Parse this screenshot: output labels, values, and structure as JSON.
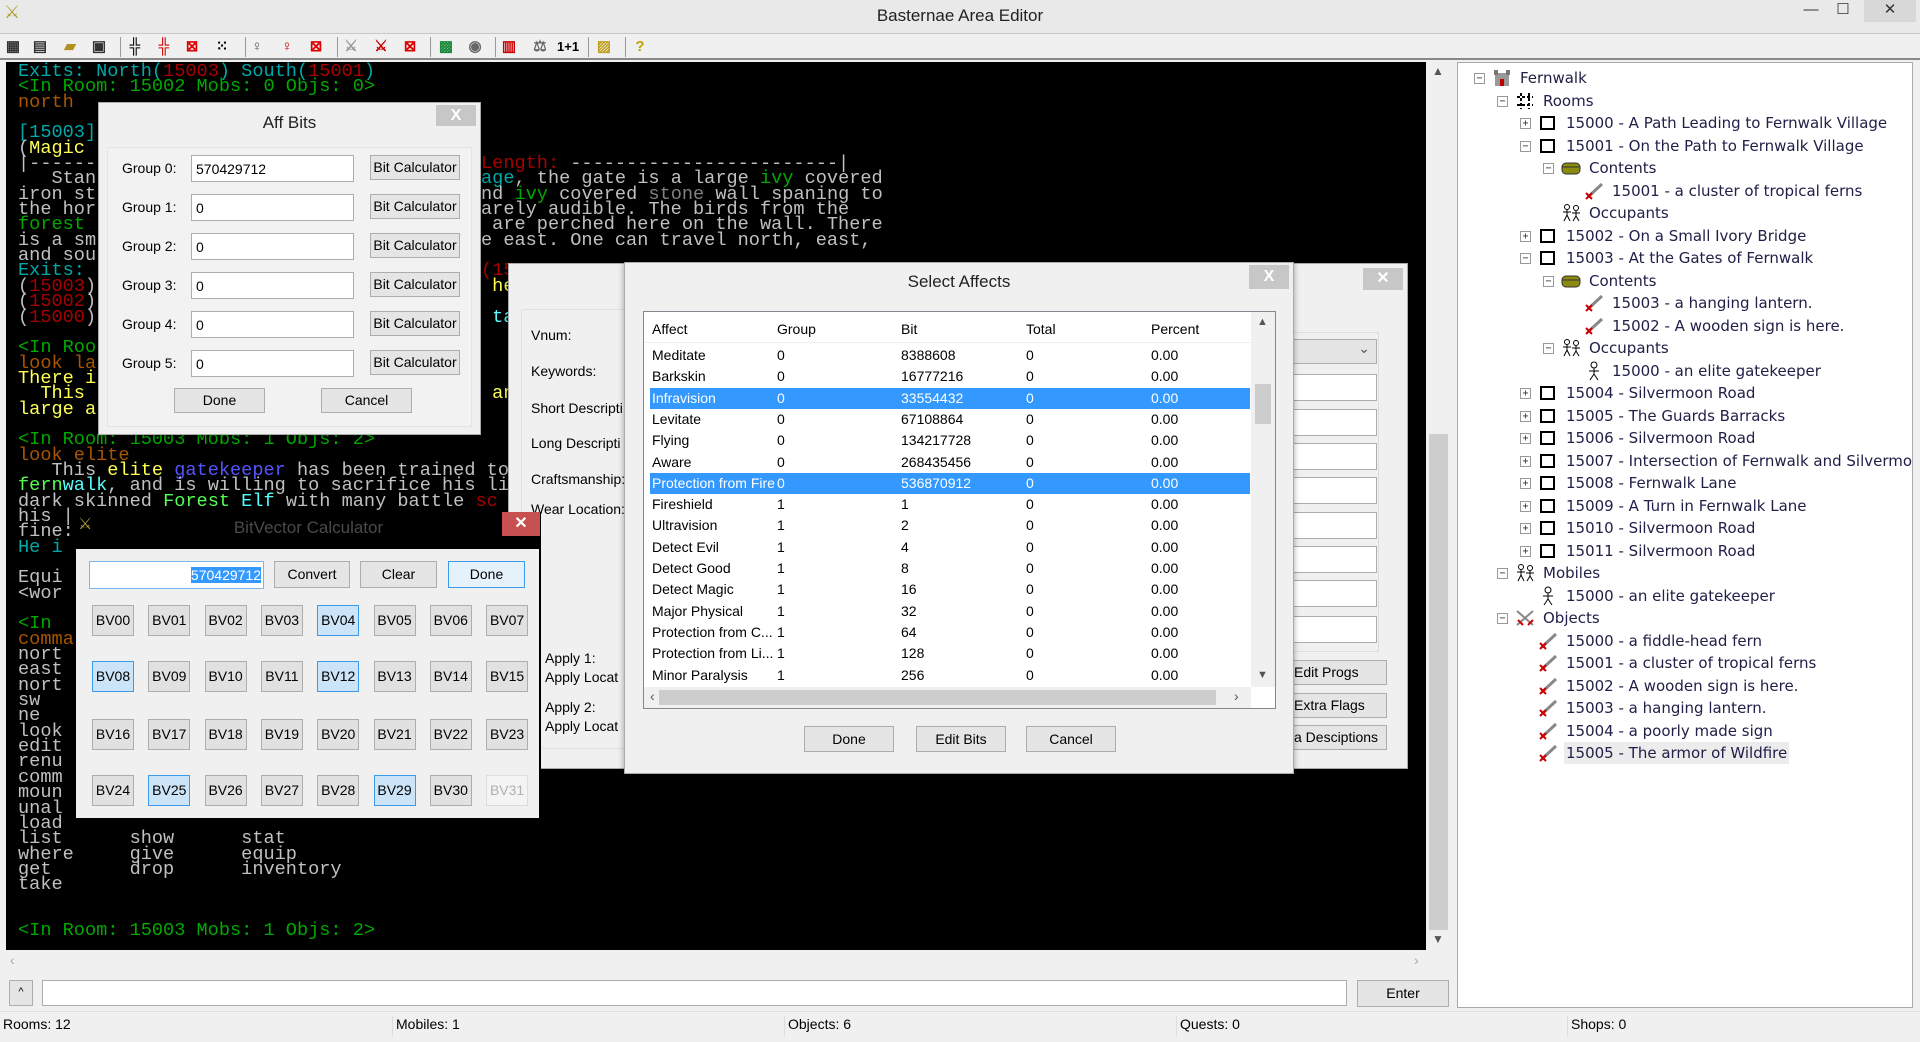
{
  "window": {
    "title": "Basternae Area Editor",
    "minimize": "—",
    "maximize": "☐",
    "close": "✕"
  },
  "toolbar": {
    "icons": [
      "new-area-icon",
      "area-properties-icon",
      "open-folder-icon",
      "save-icon",
      "rooms-icon",
      "new-room-icon",
      "delete-room-icon",
      "room-grid-icon",
      "mobile-icon",
      "new-mobile-icon",
      "delete-mobile-icon",
      "object-icon",
      "new-object-icon",
      "delete-object-icon",
      "map-icon",
      "compass-icon",
      "bar-chart-icon",
      "balance-icon",
      "calculator-icon",
      "image-folder-icon",
      "help-icon"
    ],
    "calc_label": "1+1",
    "help_label": "?"
  },
  "terminal": {
    "palette": {
      "w": "#c0c0c0",
      "c": "#00a8a8",
      "C": "#54ffff",
      "r": "#a80000",
      "g": "#00a800",
      "G": "#54ff54",
      "o": "#a85400",
      "y": "#ffff54",
      "b": "#5454ff",
      "k": "#808080"
    },
    "lines": [
      {
        "l": [
          [
            "Exits: North(",
            "c"
          ],
          [
            "15003",
            "r"
          ],
          [
            ") South(",
            "c"
          ],
          [
            "15001",
            "r"
          ],
          [
            ")",
            "c"
          ]
        ]
      },
      {
        "l": [
          [
            "<In Room: 15002 Mobs: 0 Objs: 0>",
            "g"
          ]
        ]
      },
      {
        "l": [
          [
            "north",
            "o"
          ]
        ]
      },
      {
        "l": []
      },
      {
        "l": [
          [
            "[15003]",
            "c"
          ]
        ]
      },
      {
        "l": [
          [
            "(",
            "w"
          ],
          [
            "Magic ",
            "y"
          ]
        ]
      },
      {
        "l": [
          [
            "|------",
            "w"
          ]
        ],
        "r": [
          [
            "Length: ",
            "r"
          ],
          [
            "------------------------|",
            "w"
          ]
        ]
      },
      {
        "l": [
          [
            "   Stan",
            "w"
          ]
        ],
        "r": [
          [
            "age",
            "c"
          ],
          [
            ", the gate is a large ",
            "w"
          ],
          [
            "ivy",
            "g"
          ],
          [
            " covered",
            "w"
          ]
        ]
      },
      {
        "l": [
          [
            "iron st",
            "w"
          ]
        ],
        "r": [
          [
            "nd ",
            "w"
          ],
          [
            "ivy",
            "g"
          ],
          [
            " covered ",
            "w"
          ],
          [
            "stone",
            "k"
          ],
          [
            " wall spaning to",
            "w"
          ]
        ]
      },
      {
        "l": [
          [
            "the hor",
            "w"
          ]
        ],
        "r": [
          [
            "arely audible. The birds from the",
            "w"
          ]
        ]
      },
      {
        "l": [
          [
            "forest ",
            "g"
          ]
        ],
        "r": [
          [
            " are perched here on the wall. There",
            "w"
          ]
        ]
      },
      {
        "l": [
          [
            "is a sm",
            "w"
          ]
        ],
        "r": [
          [
            "e east. One can travel north, east,",
            "w"
          ]
        ]
      },
      {
        "l": [
          [
            "and sou",
            "w"
          ]
        ]
      },
      {
        "l": [
          [
            "Exits: ",
            "c"
          ]
        ],
        "r": [
          [
            "(15",
            "r"
          ]
        ]
      },
      {
        "l": [
          [
            "(",
            "w"
          ],
          [
            "15003",
            "r"
          ],
          [
            ")",
            "w"
          ]
        ],
        "r": [
          [
            " he",
            "y"
          ]
        ]
      },
      {
        "l": [
          [
            "(",
            "w"
          ],
          [
            "15002",
            "r"
          ],
          [
            ")",
            "w"
          ]
        ]
      },
      {
        "l": [
          [
            "(",
            "w"
          ],
          [
            "15000",
            "r"
          ],
          [
            ")",
            "w"
          ]
        ],
        "r": [
          [
            " tan",
            "C"
          ]
        ]
      },
      {
        "l": []
      },
      {
        "l": [
          [
            "<In Roo",
            "g"
          ]
        ]
      },
      {
        "l": [
          [
            "look la",
            "o"
          ]
        ]
      },
      {
        "l": [
          [
            "There i",
            "y"
          ]
        ]
      },
      {
        "l": [
          [
            "  This ",
            "y"
          ]
        ],
        "r": [
          [
            " and",
            "y"
          ]
        ]
      },
      {
        "l": [
          [
            "large a",
            "y"
          ]
        ]
      },
      {
        "l": []
      },
      {
        "l": [
          [
            "<In Room: 15003 Mobs: 1 Objs: 2>",
            "g"
          ]
        ]
      },
      {
        "l": [
          [
            "look elite",
            "o"
          ]
        ]
      },
      {
        "l": [
          [
            "   This ",
            "w"
          ],
          [
            "elite ",
            "y"
          ],
          [
            "gatekeeper",
            "b"
          ],
          [
            " has been trained to",
            "w"
          ]
        ]
      },
      {
        "l": [
          [
            "fern",
            "G"
          ],
          [
            "walk",
            "C"
          ],
          [
            ", and is willing to sacrifice his li",
            "w"
          ]
        ]
      },
      {
        "l": [
          [
            "dark skinned ",
            "w"
          ],
          [
            "Forest ",
            "G"
          ],
          [
            "Elf",
            "C"
          ],
          [
            " with many battle ",
            "w"
          ],
          [
            "sc",
            "r"
          ]
        ]
      },
      {
        "l": [
          [
            "his |",
            "w"
          ]
        ]
      },
      {
        "l": [
          [
            "fine:",
            "w"
          ]
        ]
      },
      {
        "l": [
          [
            "He i",
            "c"
          ]
        ]
      },
      {
        "l": []
      },
      {
        "l": [
          [
            "Equi",
            "w"
          ]
        ]
      },
      {
        "l": [
          [
            "<wor",
            "w"
          ]
        ]
      },
      {
        "l": []
      },
      {
        "l": [
          [
            "<In ",
            "g"
          ]
        ]
      },
      {
        "l": [
          [
            "comma",
            "o"
          ]
        ]
      },
      {
        "l": [
          [
            "nort",
            "w"
          ]
        ]
      },
      {
        "l": [
          [
            "east",
            "w"
          ]
        ]
      },
      {
        "l": [
          [
            "nort",
            "w"
          ]
        ]
      },
      {
        "l": [
          [
            "sw",
            "w"
          ]
        ]
      },
      {
        "l": [
          [
            "ne",
            "w"
          ]
        ]
      },
      {
        "l": [
          [
            "look",
            "w"
          ]
        ]
      },
      {
        "l": [
          [
            "edit",
            "w"
          ]
        ]
      },
      {
        "l": [
          [
            "renu",
            "w"
          ]
        ]
      },
      {
        "l": [
          [
            "comm",
            "w"
          ]
        ]
      },
      {
        "l": [
          [
            "moun",
            "w"
          ]
        ]
      },
      {
        "l": [
          [
            "unal",
            "w"
          ]
        ]
      },
      {
        "l": [
          [
            "load",
            "w"
          ]
        ]
      },
      {
        "l": [
          [
            "list      show      stat",
            "w"
          ]
        ]
      },
      {
        "l": [
          [
            "where     give      equip",
            "w"
          ]
        ]
      },
      {
        "l": [
          [
            "get       drop      inventory",
            "w"
          ]
        ]
      },
      {
        "l": [
          [
            "take",
            "w"
          ]
        ]
      },
      {
        "l": []
      },
      {
        "l": []
      },
      {
        "l": [
          [
            "<In Room: 15003 Mobs: 1 Objs: 2>",
            "g"
          ]
        ]
      }
    ]
  },
  "command": {
    "history_button": "^",
    "input_value": "",
    "enter_label": "Enter"
  },
  "tree": {
    "rows": [
      {
        "level": 0,
        "exp": "-",
        "icon": "castle",
        "label": "Fernwalk"
      },
      {
        "level": 1,
        "exp": "-",
        "icon": "rooms",
        "label": "Rooms"
      },
      {
        "level": 2,
        "exp": "+",
        "icon": "room",
        "label": "15000 - A Path Leading to Fernwalk Village"
      },
      {
        "level": 2,
        "exp": "-",
        "icon": "room",
        "label": "15001 - On the Path to Fernwalk Village"
      },
      {
        "level": 3,
        "exp": "-",
        "icon": "chest",
        "label": "Contents"
      },
      {
        "level": 4,
        "exp": "",
        "icon": "object",
        "label": "15001 - a cluster of tropical ferns"
      },
      {
        "level": 3,
        "exp": "",
        "icon": "mobs",
        "label": "Occupants"
      },
      {
        "level": 2,
        "exp": "+",
        "icon": "room",
        "label": "15002 - On a Small Ivory Bridge"
      },
      {
        "level": 2,
        "exp": "-",
        "icon": "room",
        "label": "15003 - At the Gates of Fernwalk"
      },
      {
        "level": 3,
        "exp": "-",
        "icon": "chest",
        "label": "Contents"
      },
      {
        "level": 4,
        "exp": "",
        "icon": "object",
        "label": "15003 - a hanging lantern."
      },
      {
        "level": 4,
        "exp": "",
        "icon": "object",
        "label": "15002 - A wooden sign is here."
      },
      {
        "level": 3,
        "exp": "-",
        "icon": "mobs",
        "label": "Occupants"
      },
      {
        "level": 4,
        "exp": "",
        "icon": "mob",
        "label": "15000 - an elite gatekeeper"
      },
      {
        "level": 2,
        "exp": "+",
        "icon": "room",
        "label": "15004 - Silvermoon Road"
      },
      {
        "level": 2,
        "exp": "+",
        "icon": "room",
        "label": "15005 - The Guards Barracks"
      },
      {
        "level": 2,
        "exp": "+",
        "icon": "room",
        "label": "15006 - Silvermoon Road"
      },
      {
        "level": 2,
        "exp": "+",
        "icon": "room",
        "label": "15007 - Intersection of Fernwalk and Silvermoon"
      },
      {
        "level": 2,
        "exp": "+",
        "icon": "room",
        "label": "15008 - Fernwalk Lane"
      },
      {
        "level": 2,
        "exp": "+",
        "icon": "room",
        "label": "15009 - A Turn in Fernwalk Lane"
      },
      {
        "level": 2,
        "exp": "+",
        "icon": "room",
        "label": "15010 - Silvermoon Road"
      },
      {
        "level": 2,
        "exp": "+",
        "icon": "room",
        "label": "15011 - Silvermoon Road"
      },
      {
        "level": 1,
        "exp": "-",
        "icon": "mobs",
        "label": "Mobiles"
      },
      {
        "level": 2,
        "exp": "",
        "icon": "mob",
        "label": "15000 - an elite gatekeeper"
      },
      {
        "level": 1,
        "exp": "-",
        "icon": "objects",
        "label": "Objects"
      },
      {
        "level": 2,
        "exp": "",
        "icon": "object",
        "label": "15000 - a fiddle-head fern"
      },
      {
        "level": 2,
        "exp": "",
        "icon": "object",
        "label": "15001 - a cluster of tropical ferns"
      },
      {
        "level": 2,
        "exp": "",
        "icon": "object",
        "label": "15002 - A wooden sign is here."
      },
      {
        "level": 2,
        "exp": "",
        "icon": "object",
        "label": "15003 - a hanging lantern."
      },
      {
        "level": 2,
        "exp": "",
        "icon": "object",
        "label": "15004 - a poorly made sign"
      },
      {
        "level": 2,
        "exp": "",
        "icon": "object",
        "label": "15005 - The armor of Wildfire",
        "selected": true
      }
    ]
  },
  "status": {
    "rooms": "Rooms: 12",
    "mobiles": "Mobiles: 1",
    "objects": "Objects: 6",
    "quests": "Quests: 0",
    "shops": "Shops: 0"
  },
  "aff_bits": {
    "title": "Aff Bits",
    "close": "X",
    "groups": [
      {
        "label": "Group 0:",
        "value": "570429712"
      },
      {
        "label": "Group 1:",
        "value": "0"
      },
      {
        "label": "Group 2:",
        "value": "0"
      },
      {
        "label": "Group 3:",
        "value": "0"
      },
      {
        "label": "Group 4:",
        "value": "0"
      },
      {
        "label": "Group 5:",
        "value": "0"
      }
    ],
    "calc_label": "Bit Calculator",
    "done": "Done",
    "cancel": "Cancel"
  },
  "object_editor": {
    "close": "✕",
    "labels": [
      "Vnum:",
      "Keywords:",
      "Short Descripti",
      "Long Descripti",
      "Craftsmanship:",
      "Wear Location:"
    ],
    "apply1": "Apply 1:",
    "apply1_loc": "Apply Locat",
    "apply2": "Apply 2:",
    "apply2_loc": "Apply Locat",
    "edit_progs": "Edit Progs",
    "extra_flags": "Extra Flags",
    "extra_desc": "a Desciptions"
  },
  "select_affects": {
    "title": "Select Affects",
    "close": "X",
    "columns": [
      "Affect",
      "Group",
      "Bit",
      "Total",
      "Percent"
    ],
    "rows": [
      {
        "affect": "Meditate",
        "group": "0",
        "bit": "8388608",
        "total": "0",
        "percent": "0.00"
      },
      {
        "affect": "Barkskin",
        "group": "0",
        "bit": "16777216",
        "total": "0",
        "percent": "0.00"
      },
      {
        "affect": "Infravision",
        "group": "0",
        "bit": "33554432",
        "total": "0",
        "percent": "0.00",
        "selected": true
      },
      {
        "affect": "Levitate",
        "group": "0",
        "bit": "67108864",
        "total": "0",
        "percent": "0.00"
      },
      {
        "affect": "Flying",
        "group": "0",
        "bit": "134217728",
        "total": "0",
        "percent": "0.00"
      },
      {
        "affect": "Aware",
        "group": "0",
        "bit": "268435456",
        "total": "0",
        "percent": "0.00"
      },
      {
        "affect": "Protection from Fire",
        "group": "0",
        "bit": "536870912",
        "total": "0",
        "percent": "0.00",
        "selected": true
      },
      {
        "affect": "Fireshield",
        "group": "1",
        "bit": "1",
        "total": "0",
        "percent": "0.00"
      },
      {
        "affect": "Ultravision",
        "group": "1",
        "bit": "2",
        "total": "0",
        "percent": "0.00"
      },
      {
        "affect": "Detect Evil",
        "group": "1",
        "bit": "4",
        "total": "0",
        "percent": "0.00"
      },
      {
        "affect": "Detect Good",
        "group": "1",
        "bit": "8",
        "total": "0",
        "percent": "0.00"
      },
      {
        "affect": "Detect Magic",
        "group": "1",
        "bit": "16",
        "total": "0",
        "percent": "0.00"
      },
      {
        "affect": "Major Physical",
        "group": "1",
        "bit": "32",
        "total": "0",
        "percent": "0.00"
      },
      {
        "affect": "Protection from C...",
        "group": "1",
        "bit": "64",
        "total": "0",
        "percent": "0.00"
      },
      {
        "affect": "Protection from Li...",
        "group": "1",
        "bit": "128",
        "total": "0",
        "percent": "0.00"
      },
      {
        "affect": "Minor Paralysis",
        "group": "1",
        "bit": "256",
        "total": "0",
        "percent": "0.00"
      }
    ],
    "done": "Done",
    "edit_bits": "Edit Bits",
    "cancel": "Cancel"
  },
  "bitvector_calc": {
    "title": "BitVector Calculator",
    "close": "✕",
    "value": "570429712",
    "convert": "Convert",
    "clear": "Clear",
    "done": "Done",
    "buttons": [
      "BV00",
      "BV01",
      "BV02",
      "BV03",
      "BV04",
      "BV05",
      "BV06",
      "BV07",
      "BV08",
      "BV09",
      "BV10",
      "BV11",
      "BV12",
      "BV13",
      "BV14",
      "BV15",
      "BV16",
      "BV17",
      "BV18",
      "BV19",
      "BV20",
      "BV21",
      "BV22",
      "BV23",
      "BV24",
      "BV25",
      "BV26",
      "BV27",
      "BV28",
      "BV29",
      "BV30",
      "BV31"
    ],
    "active": [
      "BV04",
      "BV08",
      "BV12",
      "BV25",
      "BV29"
    ],
    "disabled": [
      "BV31"
    ]
  }
}
